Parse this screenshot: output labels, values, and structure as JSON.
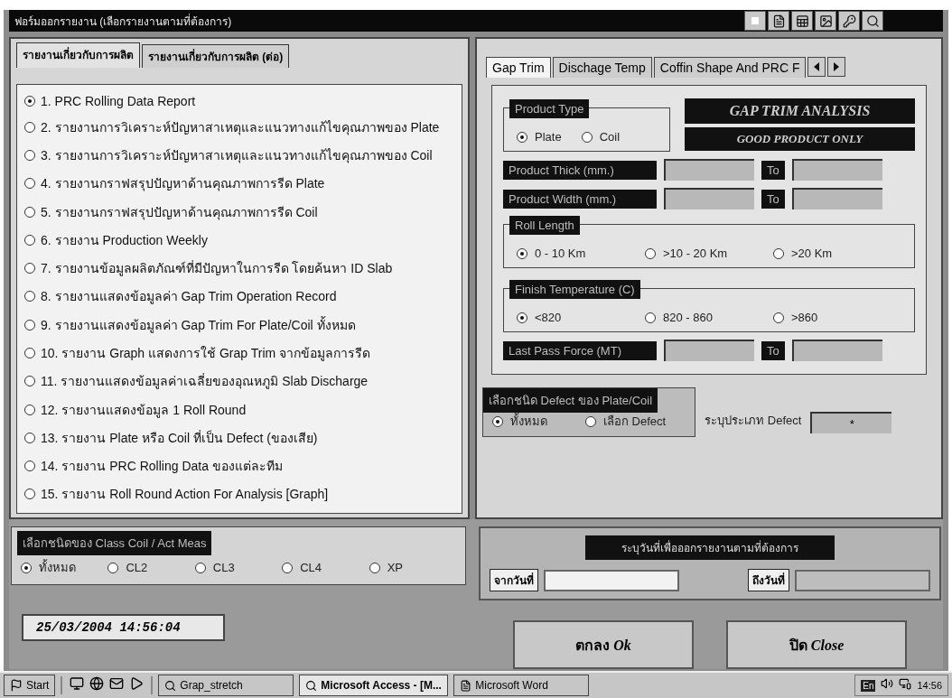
{
  "window": {
    "title": "ฟอร์มออกรายงาน (เลือกรายงานตามที่ต้องการ)"
  },
  "report_tabs": [
    {
      "label": "รายงานเกี่ยวกับการผลิต",
      "selected": true
    },
    {
      "label": "รายงานเกี่ยวกับการผลิต (ต่อ)",
      "selected": false
    }
  ],
  "reports": [
    {
      "label": "1. PRC Rolling Data Report",
      "selected": true
    },
    {
      "label": "2. รายงานการวิเคราะห์ปัญหาสาเหตุและแนวทางแก้ไขคุณภาพของ Plate",
      "selected": false
    },
    {
      "label": "3. รายงานการวิเคราะห์ปัญหาสาเหตุและแนวทางแก้ไขคุณภาพของ Coil",
      "selected": false
    },
    {
      "label": "4. รายงานกราฟสรุปปัญหาด้านคุณภาพการรีด Plate",
      "selected": false
    },
    {
      "label": "5. รายงานกราฟสรุปปัญหาด้านคุณภาพการรีด Coil",
      "selected": false
    },
    {
      "label": "6. รายงาน Production Weekly",
      "selected": false
    },
    {
      "label": "7. รายงานข้อมูลผลิตภัณฑ์ที่มีปัญหาในการรีด โดยค้นหา ID Slab",
      "selected": false
    },
    {
      "label": "8. รายงานแสดงข้อมูลค่า Gap Trim Operation Record",
      "selected": false
    },
    {
      "label": "9. รายงานแสดงข้อมูลค่า Gap Trim For Plate/Coil ทั้งหมด",
      "selected": false
    },
    {
      "label": "10. รายงาน Graph แสดงการใช้ Grap Trim จากข้อมูลการรีด",
      "selected": false
    },
    {
      "label": "11. รายงานแสดงข้อมูลค่าเฉลี่ยของอุณหภูมิ Slab Discharge",
      "selected": false
    },
    {
      "label": "12. รายงานแสดงข้อมูล 1 Roll Round",
      "selected": false
    },
    {
      "label": "13. รายงาน Plate หรือ Coil ที่เป็น Defect (ของเสีย)",
      "selected": false
    },
    {
      "label": "14. รายงาน PRC Rolling Data ของแต่ละทีม",
      "selected": false
    },
    {
      "label": "15. รายงาน Roll Round Action For Analysis [Graph]",
      "selected": false
    }
  ],
  "analysis_tabs": [
    {
      "label": "Gap Trim",
      "selected": true
    },
    {
      "label": "Dischage Temp",
      "selected": false
    },
    {
      "label": "Coffin Shape And PRC F",
      "selected": false
    }
  ],
  "product_type": {
    "label": "Product Type",
    "options": [
      {
        "label": "Plate",
        "selected": true
      },
      {
        "label": "Coil",
        "selected": false
      }
    ]
  },
  "banners": [
    "GAP TRIM ANALYSIS",
    "GOOD PRODUCT ONLY"
  ],
  "ranges": [
    {
      "label": "Product Thick (mm.)",
      "to": "To"
    },
    {
      "label": "Product Width (mm.)",
      "to": "To"
    }
  ],
  "roll_length": {
    "label": "Roll Length",
    "options": [
      {
        "label": "0 - 10 Km",
        "selected": true
      },
      {
        "label": ">10 - 20 Km",
        "selected": false
      },
      {
        "label": ">20 Km",
        "selected": false
      }
    ]
  },
  "finish_temperature": {
    "label": "Finish Temperature (C)",
    "options": [
      {
        "label": "<820",
        "selected": true
      },
      {
        "label": "820 - 860",
        "selected": false
      },
      {
        "label": ">860",
        "selected": false
      }
    ]
  },
  "last_pass_force": {
    "label": "Last Pass Force (MT)",
    "to": "To"
  },
  "defect_filter": {
    "label": "เลือกชนิด Defect ของ Plate/Coil",
    "options": [
      {
        "label": "ทั้งหมด",
        "selected": true
      },
      {
        "label": "เลือก Defect",
        "selected": false
      }
    ],
    "type_label": "ระบุประเภท Defect",
    "type_value": "*"
  },
  "class_filter": {
    "label": "เลือกชนิดของ Class Coil / Act Meas",
    "options": [
      {
        "label": "ทั้งหมด",
        "selected": true
      },
      {
        "label": "CL2",
        "selected": false
      },
      {
        "label": "CL3",
        "selected": false
      },
      {
        "label": "CL4",
        "selected": false
      },
      {
        "label": "XP",
        "selected": false
      }
    ]
  },
  "date_range": {
    "title": "ระบุวันที่เพื่อออกรายงานตามที่ต้องการ",
    "from_label": "จากวันที่",
    "to_label": "ถึงวันที่"
  },
  "timestamp": "25/03/2004 14:56:04",
  "buttons": [
    "ตกลง *Ok*",
    "ปิด *Close*"
  ],
  "taskbar": {
    "start": "Start",
    "tasks": [
      {
        "label": "Grap_stretch",
        "selected": false
      },
      {
        "label": "Microsoft Access - [M...",
        "selected": true
      },
      {
        "label": "Microsoft Word",
        "selected": false
      }
    ],
    "language": "En",
    "clock": "14:56"
  }
}
